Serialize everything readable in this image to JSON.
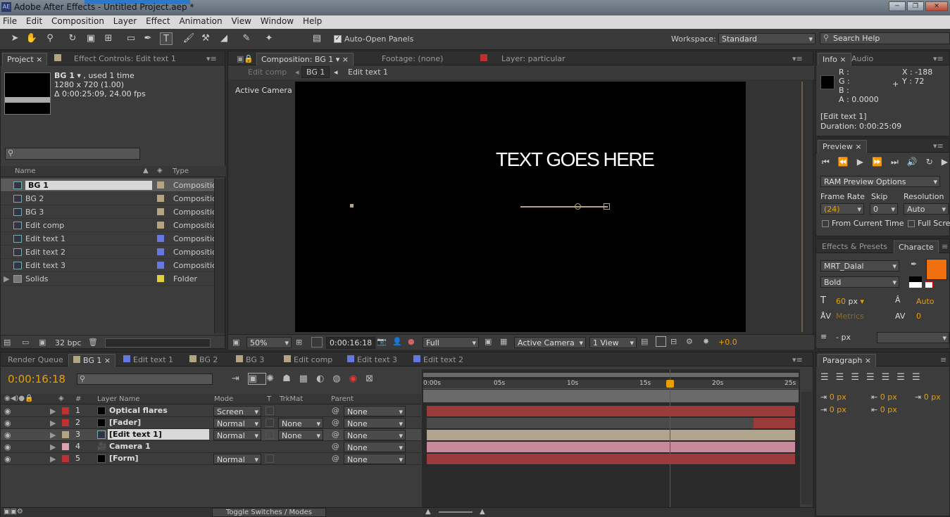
{
  "window": {
    "title": "Adobe After Effects - Untitled Project.aep *",
    "app_badge": "AE"
  },
  "menu": [
    "File",
    "Edit",
    "Composition",
    "Layer",
    "Effect",
    "Animation",
    "View",
    "Window",
    "Help"
  ],
  "toolbar": {
    "auto_open_panels": "Auto-Open Panels",
    "workspace_label": "Workspace:",
    "workspace_value": "Standard",
    "search_placeholder": "Search Help"
  },
  "project": {
    "tab_project": "Project",
    "tab_effect_controls": "Effect Controls: Edit text 1",
    "selected_name": "BG 1",
    "selected_used": ", used 1 time",
    "selected_dims": "1280 x 720 (1.00)",
    "selected_duration": "Δ 0:00:25:09, 24.00 fps",
    "col_name": "Name",
    "col_type": "Type",
    "items": [
      {
        "name": "BG 1",
        "type": "Compositio",
        "color": "#b5a482"
      },
      {
        "name": "BG 2",
        "type": "Compositio",
        "color": "#b5a482"
      },
      {
        "name": "BG 3",
        "type": "Compositio",
        "color": "#b5a482"
      },
      {
        "name": "Edit comp",
        "type": "Compositio",
        "color": "#b5a482"
      },
      {
        "name": "Edit text 1",
        "type": "Compositio",
        "color": "#6478e0"
      },
      {
        "name": "Edit text 2",
        "type": "Compositio",
        "color": "#6478e0"
      },
      {
        "name": "Edit text 3",
        "type": "Compositio",
        "color": "#6478e0"
      },
      {
        "name": "Solids",
        "type": "Folder",
        "color": "#e0d040"
      }
    ],
    "bpc": "32 bpc"
  },
  "composition": {
    "tab_comp": "Composition: BG 1",
    "tab_footage": "Footage: (none)",
    "tab_layer": "Layer: particular",
    "crumb_edit_comp": "Edit comp",
    "crumb_bg1": "BG 1",
    "crumb_edit_text": "Edit text 1",
    "camera_label": "Active Camera",
    "viewer_text": "TEXT GOES HERE",
    "zoom": "50%",
    "timecode": "0:00:16:18",
    "resolution": "Full",
    "camera_dd": "Active Camera",
    "views": "1 View",
    "exposure": "+0.0"
  },
  "info": {
    "tab_info": "Info",
    "tab_audio": "Audio",
    "r": "R :",
    "g": "G :",
    "b": "B :",
    "a": "A : 0.0000",
    "x": "X : -188",
    "y": "Y : 72",
    "layer": "[Edit text 1]",
    "duration": "Duration: 0:00:25:09"
  },
  "preview": {
    "tab": "Preview",
    "ram_options": "RAM Preview Options",
    "frame_rate_label": "Frame Rate",
    "skip_label": "Skip",
    "resolution_label": "Resolution",
    "frame_rate": "(24)",
    "skip": "0",
    "resolution": "Auto",
    "from_current": "From Current Time",
    "full_screen": "Full Scree"
  },
  "character": {
    "tab_effects": "Effects & Presets",
    "tab_character": "Characte",
    "font": "MRT_Dalal",
    "style": "Bold",
    "size": "60",
    "size_unit": "px",
    "leading": "Auto",
    "kerning": "Metrics",
    "tracking": "0",
    "stroke_unit": "- px",
    "fill_color": "#f07010"
  },
  "paragraph": {
    "tab": "Paragraph",
    "v1": "0 px",
    "v2": "0 px",
    "v3": "0 px",
    "v4": "0 px",
    "v5": "0 px"
  },
  "timeline": {
    "tabs": [
      {
        "label": "Render Queue",
        "color": ""
      },
      {
        "label": "BG 1",
        "color": "#b5a482"
      },
      {
        "label": "Edit text 1",
        "color": "#6478e0"
      },
      {
        "label": "BG 2",
        "color": "#b5a482"
      },
      {
        "label": "BG 3",
        "color": "#b5a482"
      },
      {
        "label": "Edit comp",
        "color": "#b5a482"
      },
      {
        "label": "Edit text 3",
        "color": "#6478e0"
      },
      {
        "label": "Edit text 2",
        "color": "#6478e0"
      }
    ],
    "timecode": "0:00:16:18",
    "headers": {
      "hash": "#",
      "layer_name": "Layer Name",
      "mode": "Mode",
      "t": "T",
      "trkmat": "TrkMat",
      "parent": "Parent"
    },
    "ruler": [
      "0:00s",
      "05s",
      "10s",
      "15s",
      "20s",
      "25s"
    ],
    "layers": [
      {
        "num": "1",
        "name": "Optical flares",
        "mode": "Screen",
        "trkmat": "",
        "parent": "None",
        "label": "#c03030",
        "bar_color": "#9a3a3a"
      },
      {
        "num": "2",
        "name": "[Fader]",
        "mode": "Normal",
        "trkmat": "None",
        "parent": "None",
        "label": "#c03030",
        "bar_color": "#6a6a6a"
      },
      {
        "num": "3",
        "name": "[Edit text 1]",
        "mode": "Normal",
        "trkmat": "None",
        "parent": "None",
        "label": "#b5a482",
        "bar_color": "#b0a48c"
      },
      {
        "num": "4",
        "name": "Camera 1",
        "mode": "",
        "trkmat": "",
        "parent": "None",
        "label": "#e0a0b0",
        "bar_color": "#c78a9a"
      },
      {
        "num": "5",
        "name": "[Form]",
        "mode": "Normal",
        "trkmat": "",
        "parent": "None",
        "label": "#c03030",
        "bar_color": "#9a3a3a"
      }
    ],
    "toggle_label": "Toggle Switches / Modes"
  }
}
